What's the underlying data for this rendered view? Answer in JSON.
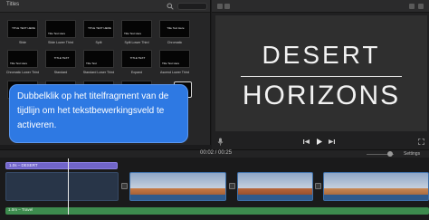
{
  "browser": {
    "title": "Titles",
    "tiles": [
      {
        "label": "Slide",
        "thumb": "TITLE TEXT HERE"
      },
      {
        "label": "Slide Lower Third",
        "thumb": "Title Text Here"
      },
      {
        "label": "Split",
        "thumb": "TITLE TEXT HERE"
      },
      {
        "label": "Split Lower Third",
        "thumb": "Title Text Here"
      },
      {
        "label": "Chromatic",
        "thumb": "Title Text Here"
      },
      {
        "label": "Chromatic Lower Third",
        "thumb": "Title Text Here"
      },
      {
        "label": "Standard",
        "thumb": "TITLE TEXT"
      },
      {
        "label": "Standard Lower Third",
        "thumb": "Title Text"
      },
      {
        "label": "Expand",
        "thumb": "TITLE TEXT"
      },
      {
        "label": "Ascend Lower Third",
        "thumb": "Title Text Here"
      },
      {
        "label": "",
        "thumb": ""
      },
      {
        "label": "",
        "thumb": ""
      },
      {
        "label": "",
        "thumb": ""
      },
      {
        "label": "",
        "thumb": ""
      },
      {
        "label": "",
        "thumb": ""
      }
    ]
  },
  "viewer": {
    "title_line1": "DESERT",
    "title_line2": "HORIZONS"
  },
  "timeline": {
    "timecode": "00:02 / 00:25",
    "settings_label": "Settings",
    "title_clip_label": "1.0s – DESERT",
    "audio_clip_label": "1.0m – Travel"
  },
  "tooltip": {
    "text": "Dubbelklik op het titelfragment van de tijdlijn om het tekstbewerkingsveld te activeren."
  },
  "colors": {
    "accent": "#2e79e3",
    "title_clip": "#7165c9",
    "audio_clip": "#3d8b4e"
  },
  "icons": [
    "search-icon",
    "mic-icon",
    "skip-back-icon",
    "play-icon",
    "skip-forward-icon",
    "fullscreen-icon"
  ]
}
